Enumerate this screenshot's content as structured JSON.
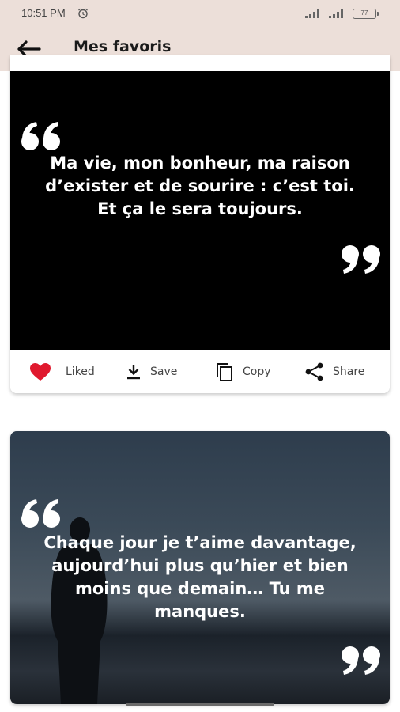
{
  "status": {
    "time": "10:51 PM",
    "battery": "77"
  },
  "header": {
    "title": "Mes favoris"
  },
  "cards": [
    {
      "quote": "Ma vie, mon bonheur, ma raison d’exister et de sourire : c’est toi. Et ça le sera toujours.",
      "actions": {
        "liked": "Liked",
        "save": "Save",
        "copy": "Copy",
        "share": "Share"
      }
    },
    {
      "quote": "Chaque jour je t’aime davantage, aujourd’hui plus qu’hier et bien moins que demain… Tu me manques."
    }
  ],
  "colors": {
    "header_bg": "#ecdfd9",
    "heart": "#e0192e",
    "quote_bg": "#000000"
  },
  "icons": [
    "back-arrow-icon",
    "heart-icon",
    "download-icon",
    "copy-icon",
    "share-icon",
    "open-quote-icon",
    "close-quote-icon"
  ]
}
